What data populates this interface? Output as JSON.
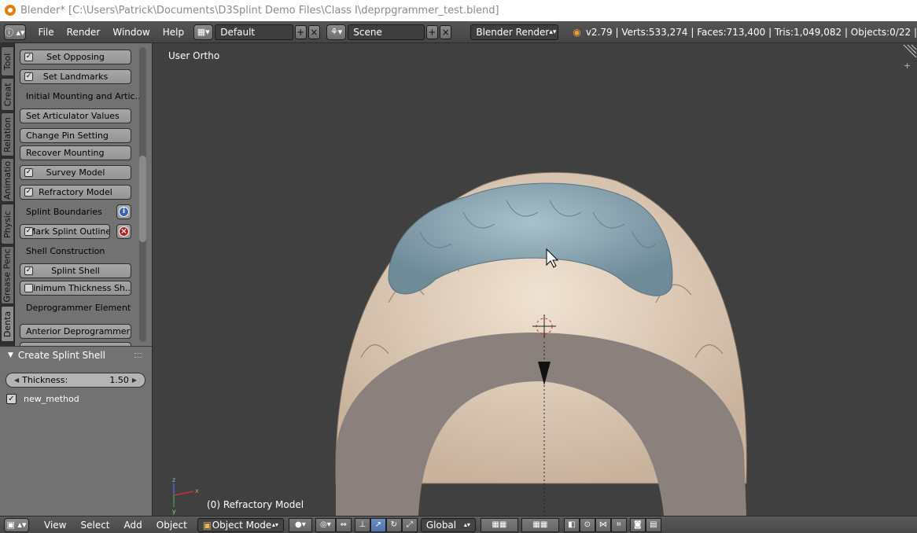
{
  "window": {
    "title": "Blender* [C:\\Users\\Patrick\\Documents\\D3Splint Demo Files\\Class I\\deprpgrammer_test.blend]"
  },
  "infobar": {
    "menus": [
      "File",
      "Render",
      "Window",
      "Help"
    ],
    "screen_layout": "Default",
    "scene": "Scene",
    "render_engine": "Blender Render",
    "stats": "v2.79 | Verts:533,274 | Faces:713,400 | Tris:1,049,082 | Objects:0/22 |"
  },
  "tool_tabs": [
    "Tool",
    "Creat",
    "Relation",
    "Animatio",
    "Physic",
    "Grease Penc",
    "Denta"
  ],
  "tool_shelf": {
    "set_opposing": "Set Opposing",
    "set_landmarks": "Set Landmarks",
    "initial_mounting": "Initial Mounting and Artic...",
    "set_articulator": "Set Articulator Values",
    "change_pin": "Change Pin Setting",
    "recover_mounting": "Recover Mounting",
    "survey_model": "Survey Model",
    "refractory_model": "Refractory Model",
    "splint_boundaries": "Splint Boundaries",
    "mark_splint_outline": "Mark Splint Outline",
    "shell_construction": "Shell Construction",
    "splint_shell": "Splint Shell",
    "minimum_thickness": "Minimum Thickness Sh...",
    "deprogrammer_element": "Deprogrammer Element",
    "anterior_deprogrammer": "Anterior Deprogrammer ..."
  },
  "operator_panel": {
    "title": "Create Splint Shell",
    "thickness_label": "Thickness:",
    "thickness_value": "1.50",
    "new_method_label": "new_method",
    "new_method_checked": true
  },
  "viewport": {
    "view_label": "User Ortho",
    "object_label": "(0) Refractory Model",
    "background_color": "#404040",
    "splint_color": "#8fa9b5",
    "model_color": "#dcc8b4",
    "base_color": "#8a817c"
  },
  "bottom_header": {
    "menus": [
      "View",
      "Select",
      "Add",
      "Object"
    ],
    "mode": "Object Mode",
    "orientation": "Global"
  }
}
